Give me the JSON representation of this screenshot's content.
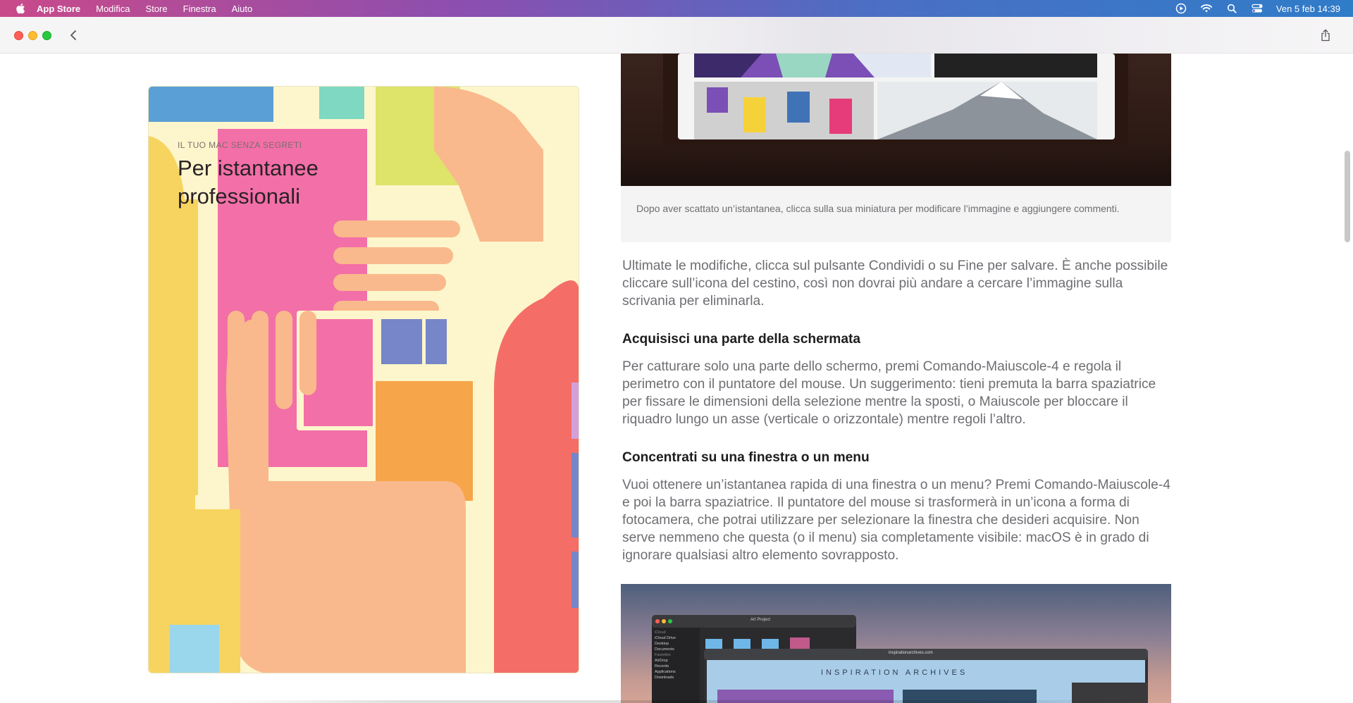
{
  "menubar": {
    "app_name": "App Store",
    "items": [
      "Modifica",
      "Store",
      "Finestra",
      "Aiuto"
    ],
    "datetime": "Ven 5 feb  14:39"
  },
  "cover": {
    "eyebrow": "IL TUO MAC SENZA SEGRETI",
    "title": "Per istantanee professionali"
  },
  "article": {
    "caption": "Dopo aver scattato un’istantanea, clicca sulla sua miniatura per modificare l’immagine e aggiungere commenti.",
    "paragraph_1": "Ultimate le modifiche, clicca sul pulsante Condividi o su Fine per salvare. È anche possibile cliccare sull’icona del cestino, così non dovrai più andare a cercare l’immagine sulla scrivania per eliminarla.",
    "heading_1": "Acquisisci una parte della schermata",
    "paragraph_2": "Per catturare solo una parte dello schermo, premi Comando-Maiuscole-4 e regola il perimetro con il puntatore del mouse. Un suggerimento: tieni premuta la barra spaziatrice per fissare le dimensioni della selezione mentre la sposti, o Maiuscole per bloccare il riquadro lungo un asse (verticale o orizzontale) mentre regoli l’altro.",
    "heading_2": "Concentrati su una finestra o un menu",
    "paragraph_3": "Vuoi ottenere un’istantanea rapida di una finestra o un menu? Premi Comando-Maiuscole-4 e poi la barra spaziatrice. Il puntatore del mouse si trasformerà in un’icona a forma di fotocamera, che potrai utilizzare per selezionare la finestra che desideri acquisire. Non serve nemmeno che questa (o il menu) sia completamente visibile: macOS è in grado di ignorare qualsiasi altro elemento sovrapposto."
  },
  "bottom_screenshot": {
    "window_title": "Art Project",
    "banner_text": "INSPIRATION ARCHIVES",
    "url": "inspirationarchives.com",
    "sidebar_items": [
      "iCloud Drive",
      "Desktop",
      "Documents",
      "AirDrop",
      "Recents",
      "Applications",
      "Downloads"
    ],
    "sidebar_headers": [
      "iCloud",
      "Favorites"
    ]
  }
}
